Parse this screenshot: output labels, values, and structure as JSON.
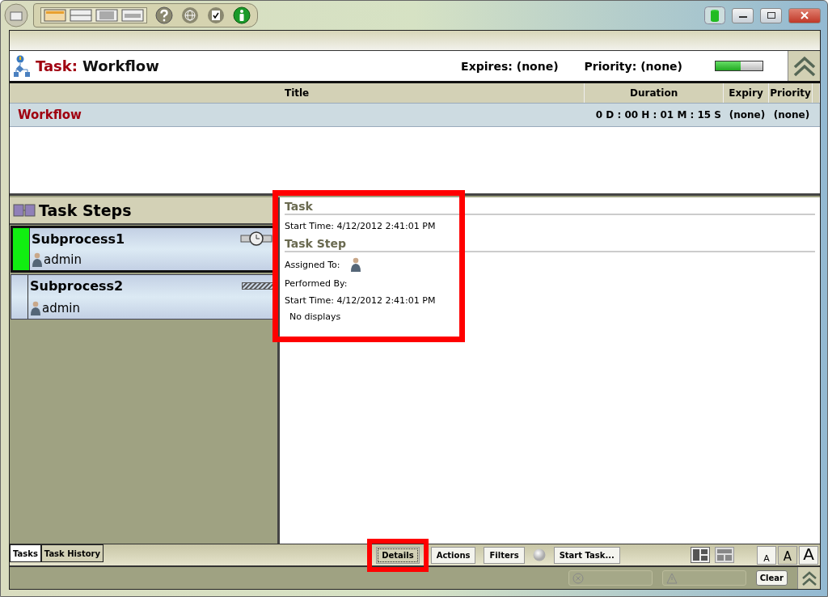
{
  "header": {
    "task_label": "Task:",
    "task_name": "Workflow",
    "expires": "Expires: (none)",
    "priority": "Priority: (none)",
    "progress": {
      "level": 0.53
    }
  },
  "table": {
    "columns": [
      "Title",
      "Duration",
      "Expiry",
      "Priority"
    ],
    "rows": [
      {
        "title": "Workflow",
        "duration": "0 D : 00 H : 01 M : 15 S",
        "expiry": "(none)",
        "priority": "(none)",
        "selected": true
      }
    ]
  },
  "task_steps": {
    "title": "Task Steps",
    "items": [
      {
        "name": "Subprocess1",
        "user": "admin",
        "selected": true,
        "kind": "timer"
      },
      {
        "name": "Subprocess2",
        "user": "admin",
        "selected": false,
        "kind": "pending"
      }
    ]
  },
  "details": {
    "sections": [
      {
        "title": "Task",
        "fields": [
          {
            "label": "Start Time: 4/12/2012 2:41:01 PM",
            "kind": "text"
          }
        ]
      },
      {
        "title": "Task Step",
        "fields": [
          {
            "label": "Assigned To:",
            "kind": "user"
          },
          {
            "label": "Performed By:",
            "kind": "text"
          },
          {
            "label": "Start Time: 4/12/2012 2:41:01 PM",
            "kind": "text"
          }
        ]
      }
    ],
    "note": "No displays"
  },
  "bottom_tabs": [
    {
      "label": "Tasks",
      "selected": true
    },
    {
      "label": "Task History",
      "selected": false
    }
  ],
  "bottom_buttons": [
    {
      "label": "Details",
      "kind": "button",
      "focused": true
    },
    {
      "label": "Actions",
      "kind": "button",
      "focused": false
    },
    {
      "label": "Filters",
      "kind": "button",
      "focused": false
    },
    {
      "kind": "indicator"
    },
    {
      "label": "Start Task...",
      "kind": "button",
      "focused": false
    }
  ],
  "font_sizes": [
    {
      "label": "A",
      "kind": "small",
      "selected": false
    },
    {
      "label": "A",
      "kind": "medium",
      "selected": true
    },
    {
      "label": "A",
      "kind": "large",
      "selected": false
    }
  ],
  "status_bar": {
    "clear": "Clear"
  }
}
